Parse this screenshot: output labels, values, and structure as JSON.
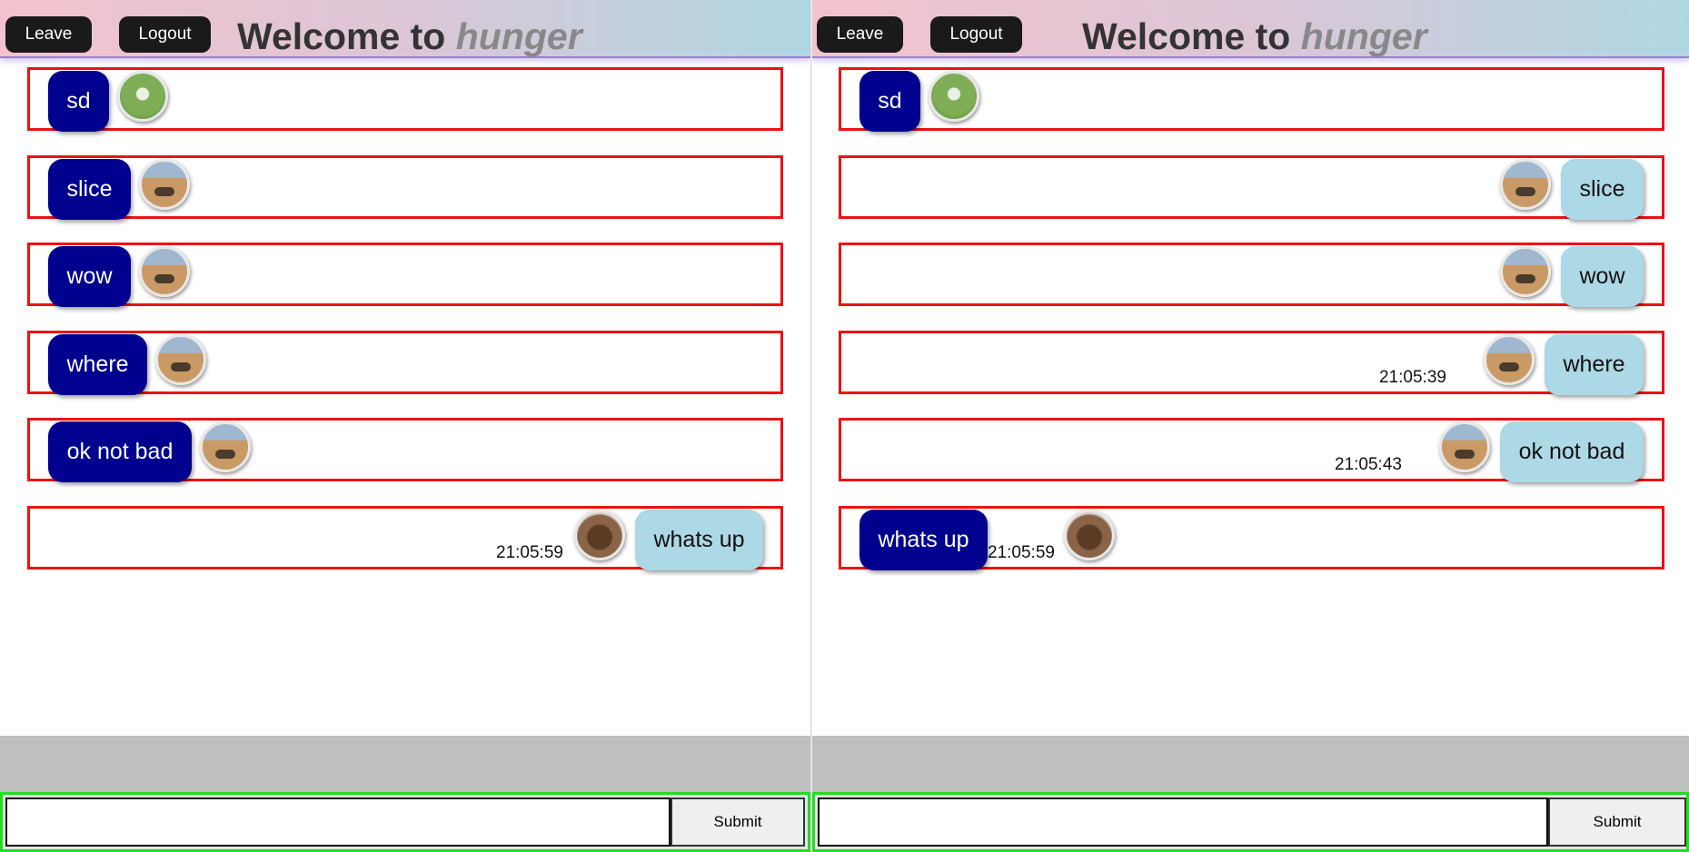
{
  "header": {
    "leave_label": "Leave",
    "logout_label": "Logout",
    "title_prefix": "Welcome to",
    "room_name": "hunger"
  },
  "left_pane": {
    "messages": [
      {
        "text": "sd",
        "avatar": "plant-avatar",
        "time": ""
      },
      {
        "text": "slice",
        "avatar": "beach-avatar",
        "time": ""
      },
      {
        "text": "wow",
        "avatar": "beach-avatar",
        "time": ""
      },
      {
        "text": "where",
        "avatar": "beach-avatar",
        "time": ""
      },
      {
        "text": "ok not bad",
        "avatar": "beach-avatar",
        "time": ""
      },
      {
        "text": "whats up",
        "avatar": "dog-avatar",
        "time": "21:05:59"
      }
    ]
  },
  "right_pane": {
    "messages": [
      {
        "text": "sd",
        "avatar": "plant-avatar",
        "time": ""
      },
      {
        "text": "slice",
        "avatar": "beach-avatar",
        "time": ""
      },
      {
        "text": "wow",
        "avatar": "beach-avatar",
        "time": ""
      },
      {
        "text": "where",
        "avatar": "beach-avatar",
        "time": "21:05:39"
      },
      {
        "text": "ok not bad",
        "avatar": "beach-avatar",
        "time": "21:05:43"
      },
      {
        "text": "whats up",
        "avatar": "dog-avatar",
        "time": "21:05:59"
      }
    ]
  },
  "composer": {
    "input_value": "",
    "submit_label": "Submit"
  },
  "colors": {
    "own_bubble": "#00008f",
    "other_bubble": "#add8e6",
    "message_border": "#ee1111",
    "composer_border": "#22dd22"
  }
}
